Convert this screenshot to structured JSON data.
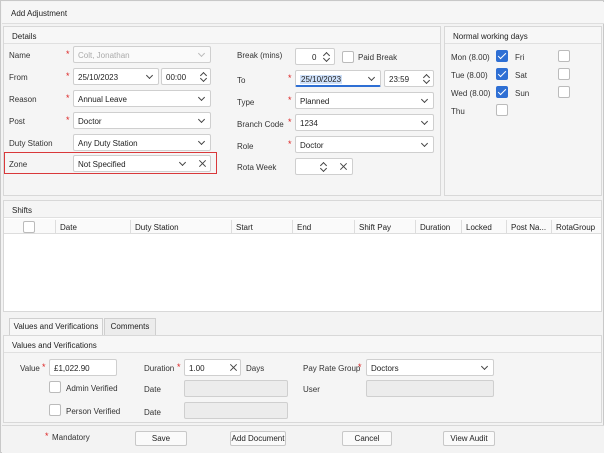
{
  "window": {
    "title": "Add Adjustment"
  },
  "details": {
    "title": "Details",
    "name": {
      "label": "Name",
      "value": "Colt, Jonathan"
    },
    "from": {
      "label": "From",
      "date": "25/10/2023",
      "time": "00:00"
    },
    "reason": {
      "label": "Reason",
      "value": "Annual Leave"
    },
    "post": {
      "label": "Post",
      "value": "Doctor"
    },
    "duty_station": {
      "label": "Duty Station",
      "value": "Any Duty Station"
    },
    "zone": {
      "label": "Zone",
      "value": "Not Specified"
    },
    "break": {
      "label": "Break (mins)",
      "value": "0",
      "paid_label": "Paid Break"
    },
    "to": {
      "label": "To",
      "date": "25/10/2023",
      "time": "23:59"
    },
    "type": {
      "label": "Type",
      "value": "Planned"
    },
    "branch_code": {
      "label": "Branch Code",
      "value": "1234"
    },
    "role": {
      "label": "Role",
      "value": "Doctor"
    },
    "rota_week": {
      "label": "Rota Week",
      "value": ""
    }
  },
  "working_days": {
    "title": "Normal working days",
    "days": [
      {
        "label": "Mon (8.00)",
        "checked": true
      },
      {
        "label": "Tue (8.00)",
        "checked": true
      },
      {
        "label": "Wed (8.00)",
        "checked": true
      },
      {
        "label": "Thu",
        "checked": false
      },
      {
        "label": "Fri",
        "checked": false
      },
      {
        "label": "Sat",
        "checked": false
      },
      {
        "label": "Sun",
        "checked": false
      }
    ]
  },
  "shifts": {
    "title": "Shifts",
    "columns": [
      "Date",
      "Duty Station",
      "Start",
      "End",
      "Shift Pay",
      "Duration",
      "Locked",
      "Post Na...",
      "RotaGroup"
    ]
  },
  "tabs": [
    "Values and Verifications",
    "Comments"
  ],
  "values": {
    "title": "Values and Verifications",
    "value": {
      "label": "Value",
      "amount": "£1,022.90"
    },
    "duration": {
      "label": "Duration",
      "value": "1.00",
      "unit": "Days"
    },
    "pay_rate_group": {
      "label": "Pay Rate Group",
      "value": "Doctors"
    },
    "admin_verified": "Admin Verified",
    "person_verified": "Person Verified",
    "date_label": "Date",
    "user_label": "User"
  },
  "footer": {
    "mandatory": "Mandatory",
    "save": "Save",
    "add_document": "Add Document",
    "cancel": "Cancel",
    "view_audit": "View Audit"
  },
  "colors": {
    "accent": "#2e6fd4",
    "required": "#dd2222",
    "highlight_border": "#d9383a"
  }
}
